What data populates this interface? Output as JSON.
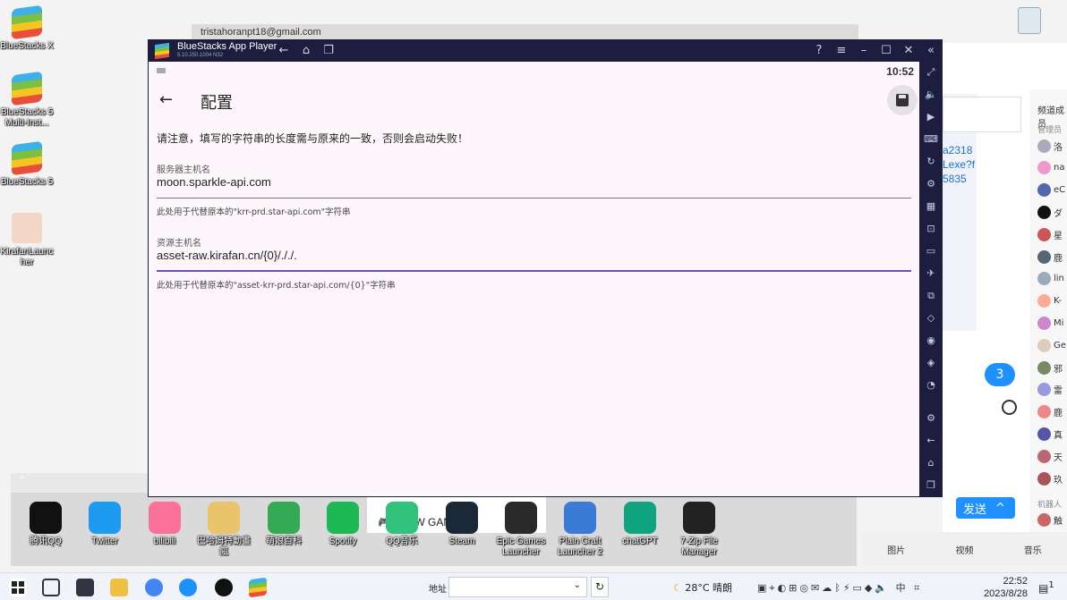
{
  "desktop": {
    "icons": [
      {
        "label": "BlueStacks X"
      },
      {
        "label": "BlueStacks 5 Multi-Inst..."
      },
      {
        "label": "BlueStacks 5"
      },
      {
        "label": "KirafanLauncher"
      }
    ]
  },
  "background_browser": {
    "account": "tristahoranpt18@gmail.com"
  },
  "chat": {
    "links": [
      "a2318",
      "Lexe?f",
      "5835"
    ],
    "member_title": "频道成员",
    "admin_label": "管理员",
    "bot_label": "机器人",
    "members": [
      "洛",
      "na",
      "eC",
      "ダ",
      "星",
      "鹿",
      "lin",
      "K-",
      "Mi",
      "Ge",
      "邪",
      "雷",
      "鹿",
      "真",
      "天",
      "玖",
      "触"
    ],
    "unread_count": "3",
    "send_label": "发送",
    "bottom_tabs": [
      "图片",
      "视频",
      "音乐"
    ],
    "game_tab_text": "🎮 | NEW GAME!"
  },
  "shelf_apps": [
    {
      "label": "腾讯QQ",
      "color": "#111111"
    },
    {
      "label": "Twitter",
      "color": "#1d9bf0"
    },
    {
      "label": "bilibili",
      "color": "#fb7299"
    },
    {
      "label": "巴哈姆特動畫瘋",
      "color": "#e9c46a"
    },
    {
      "label": "萌娘百科",
      "color": "#33aa55"
    },
    {
      "label": "Spotify",
      "color": "#1db954"
    },
    {
      "label": "QQ音乐",
      "color": "#31c27c"
    },
    {
      "label": "Steam",
      "color": "#1b2838"
    },
    {
      "label": "Epic Games Launcher",
      "color": "#2a2a2a"
    },
    {
      "label": "Plain Craft Launcher 2",
      "color": "#3a7bd5"
    },
    {
      "label": "chatGPT",
      "color": "#10a37f"
    },
    {
      "label": "7-Zip File Manager",
      "color": "#222222"
    }
  ],
  "bluestacks": {
    "app_name": "BlueStacks App Player",
    "version": "5.10.250.1004  N32"
  },
  "android": {
    "time": "10:52",
    "page_title": "配置",
    "warning": "请注意，填写的字符串的长度需与原来的一致，否则会启动失败！",
    "server_label": "服务器主机名",
    "server_value": "moon.sparkle-api.com",
    "server_hint": "此处用于代替原本的\"krr-prd.star-api.com\"字符串",
    "asset_label": "资源主机名",
    "asset_value": "asset-raw.kirafan.cn/{0}/././.",
    "asset_hint": "此处用于代替原本的\"asset-krr-prd.star-api.com/{0}\"字符串"
  },
  "taskbar": {
    "address_label": "地址",
    "weather": "28°C  晴朗",
    "ime": "中",
    "time": "22:52",
    "date": "2023/8/28",
    "notifications": "1"
  }
}
